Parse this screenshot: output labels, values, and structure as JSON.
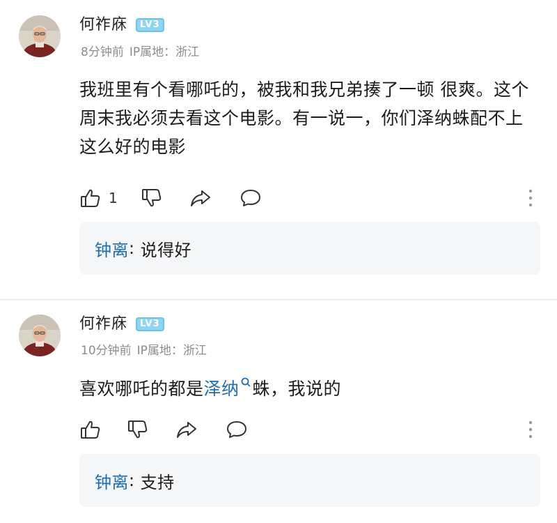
{
  "comments": [
    {
      "username": "何祚庥",
      "level_badge": "LV3",
      "time": "8分钟前",
      "ip_label": "IP属地：",
      "ip_location": "浙江",
      "content": "我班里有个看哪吒的，被我和我兄弟揍了一顿 很爽。这个周末我必须去看这个电影。有一说一，你们泽纳蛛配不上这么好的电影",
      "like_count": "1",
      "reply": {
        "author": "钟离",
        "separator": ":",
        "text": "说得好"
      }
    },
    {
      "username": "何祚庥",
      "level_badge": "LV3",
      "time": "10分钟前",
      "ip_label": "IP属地：",
      "ip_location": "浙江",
      "content_before": "喜欢哪吒的都是",
      "content_link": "泽纳",
      "content_after": "蛛，我说的",
      "like_count": "",
      "reply": {
        "author": "钟离",
        "separator": ":",
        "text": "支持"
      }
    }
  ],
  "colors": {
    "link_blue": "#1f6fb0",
    "meta_gray": "#8c8c8c",
    "badge_blue": "#8fd4f0",
    "reply_bg": "#f5f6f8"
  },
  "icons": [
    "avatar",
    "like-icon",
    "dislike-icon",
    "share-icon",
    "comment-icon",
    "more-vertical-icon",
    "search-icon"
  ]
}
